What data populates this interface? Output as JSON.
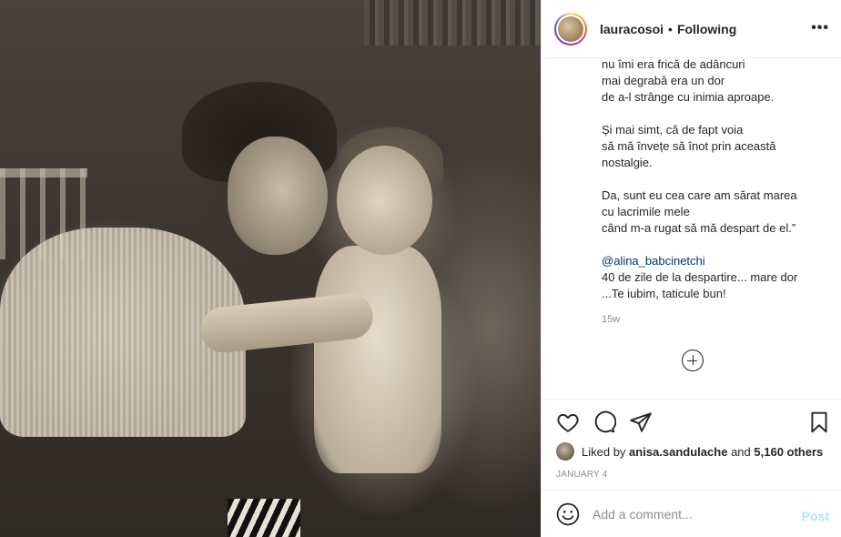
{
  "photo": {
    "alt": "Vintage sepia photo"
  },
  "header": {
    "username": "lauracosoi",
    "separator": "•",
    "follow_status": "Following",
    "more_icon": "more-horizontal-icon",
    "more_label": "•••"
  },
  "caption": {
    "lines": [
      "nu îmi era frică de adâncuri",
      "mai degrabă era un dor",
      "de a-l strânge cu inimia aproape.",
      "",
      "Și mai simt, că de fapt voia",
      "să mă învețe să înot prin această",
      "nostalgie.",
      "",
      "Da, sunt eu cea care am sărat marea",
      "cu lacrimile mele",
      "când m-a rugat să mă despart de el.”",
      ""
    ],
    "mention": "@alina_babcinetchi",
    "after_lines": [
      "40 de zile de la despartire... mare dor",
      "...Te iubim, taticule bun!"
    ],
    "time_ago": "15w"
  },
  "actions": {
    "like_icon": "heart-icon",
    "comment_icon": "comment-icon",
    "share_icon": "paper-plane-icon",
    "save_icon": "bookmark-icon"
  },
  "likes": {
    "prefix": "Liked by",
    "user": "anisa.sandulache",
    "conj": "and",
    "others": "5,160 others"
  },
  "date": "JANUARY 4",
  "comment": {
    "placeholder": "Add a comment...",
    "post_label": "Post",
    "emoji_icon": "smiley-icon"
  },
  "colors": {
    "text": "#262626",
    "muted": "#8e8e8e",
    "link": "#00376b",
    "post_disabled": "#b2dffc",
    "border": "#efefef"
  }
}
